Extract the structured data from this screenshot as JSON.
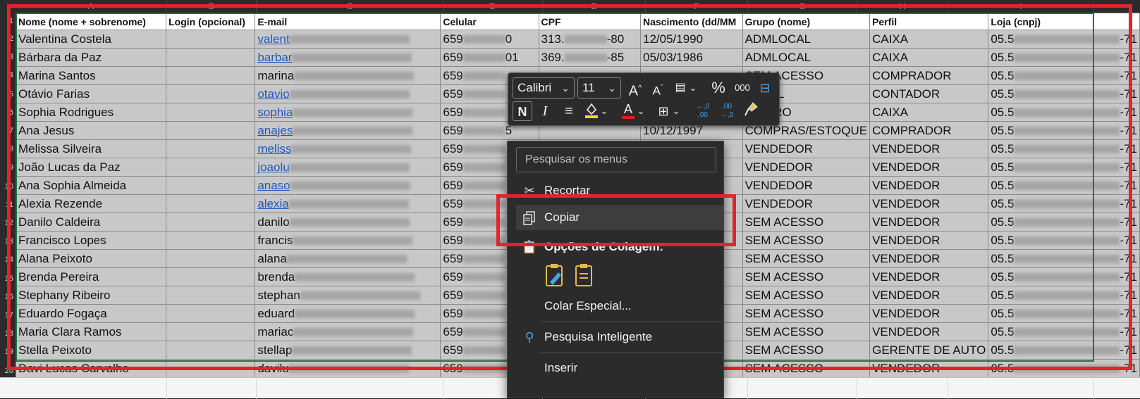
{
  "columns": [
    "A",
    "B",
    "C",
    "D",
    "E",
    "F",
    "G",
    "H",
    "I"
  ],
  "headers": [
    "Nome (nome + sobrenome)",
    "Login (opcional)",
    "E-mail",
    "Celular",
    "CPF",
    "Nascimento (dd/MM",
    "Grupo (nome)",
    "Perfil",
    "Loja (cnpj)"
  ],
  "rows": [
    {
      "n": "1",
      "nome": "Valentina Costela",
      "email": "valent",
      "email_style": "link",
      "cel_a": "659",
      "cel_b": "0",
      "cpf_a": "313.",
      "cpf_b": "-80",
      "nasc": "12/05/1990",
      "grupo": "ADMLOCAL",
      "perfil": "CAIXA",
      "loja_a": "05.5",
      "loja_b": "-71"
    },
    {
      "n": "2",
      "nome": "Bárbara da Paz",
      "email": "barbar",
      "email_style": "link",
      "cel_a": "659",
      "cel_b": "01",
      "cpf_a": "369.",
      "cpf_b": "-85",
      "nasc": "05/03/1986",
      "grupo": "ADMLOCAL",
      "perfil": "CAIXA",
      "loja_a": "05.5",
      "loja_b": "-71"
    },
    {
      "n": "3",
      "nome": "Marina Santos",
      "email": "marina",
      "email_style": "plain",
      "cel_a": "659",
      "cel_b": "",
      "cpf_a": "",
      "cpf_b": "",
      "nasc": "",
      "grupo": "SEM ACESSO",
      "perfil": "COMPRADOR",
      "loja_a": "05.5",
      "loja_b": "-71"
    },
    {
      "n": "4",
      "nome": "Otávio Farias",
      "email": "otavio",
      "email_style": "link",
      "cel_a": "659",
      "cel_b": "",
      "cpf_a": "",
      "cpf_b": "",
      "nasc": "",
      "grupo": "LOCAL",
      "perfil": "CONTADOR",
      "loja_a": "05.5",
      "loja_b": "-71"
    },
    {
      "n": "5",
      "nome": "Sophia Rodrigues",
      "email": "sophia",
      "email_style": "link",
      "cel_a": "659",
      "cel_b": "",
      "cpf_a": "",
      "cpf_b": "",
      "nasc": "",
      "grupo": "NCEIRO",
      "perfil": "CAIXA",
      "loja_a": "05.5",
      "loja_b": "-71"
    },
    {
      "n": "6",
      "nome": "Ana Jesus",
      "email": "anajes",
      "email_style": "link",
      "cel_a": "659",
      "cel_b": "5",
      "cpf_a": "",
      "cpf_b": "",
      "nasc": "10/12/1997",
      "grupo": "COMPRAS/ESTOQUE",
      "perfil": "COMPRADOR",
      "loja_a": "05.5",
      "loja_b": "-71"
    },
    {
      "n": "7",
      "nome": "Melissa Silveira",
      "email": "meliss",
      "email_style": "link",
      "cel_a": "659",
      "cel_b": "",
      "cpf_a": "",
      "cpf_b": "",
      "nasc": "",
      "grupo": "VENDEDOR",
      "perfil": "VENDEDOR",
      "loja_a": "05.5",
      "loja_b": "-71"
    },
    {
      "n": "8",
      "nome": "João Lucas da Paz",
      "email": "joaolu",
      "email_style": "link",
      "cel_a": "659",
      "cel_b": "",
      "cpf_a": "",
      "cpf_b": "",
      "nasc": "",
      "grupo": "VENDEDOR",
      "perfil": "VENDEDOR",
      "loja_a": "05.5",
      "loja_b": "-71"
    },
    {
      "n": "9",
      "nome": "Ana Sophia Almeida",
      "email": "anaso",
      "email_style": "link",
      "cel_a": "659",
      "cel_b": "",
      "cpf_a": "",
      "cpf_b": "",
      "nasc": "",
      "grupo": "VENDEDOR",
      "perfil": "VENDEDOR",
      "loja_a": "05.5",
      "loja_b": "-71"
    },
    {
      "n": "10",
      "nome": "Alexia Rezende",
      "email": "alexia",
      "email_style": "link",
      "cel_a": "659",
      "cel_b": "",
      "cpf_a": "",
      "cpf_b": "",
      "nasc": "",
      "grupo": "VENDEDOR",
      "perfil": "VENDEDOR",
      "loja_a": "05.5",
      "loja_b": "-71"
    },
    {
      "n": "11",
      "nome": "Danilo Caldeira",
      "email": "danilo",
      "email_style": "plain",
      "cel_a": "659",
      "cel_b": "",
      "cpf_a": "",
      "cpf_b": "",
      "nasc": "",
      "grupo": "SEM ACESSO",
      "perfil": "VENDEDOR",
      "loja_a": "05.5",
      "loja_b": "-71"
    },
    {
      "n": "12",
      "nome": "Francisco Lopes",
      "email": "francis",
      "email_style": "plain",
      "cel_a": "659",
      "cel_b": "",
      "cpf_a": "",
      "cpf_b": "",
      "nasc": "",
      "grupo": "SEM ACESSO",
      "perfil": "VENDEDOR",
      "loja_a": "05.5",
      "loja_b": "-71"
    },
    {
      "n": "13",
      "nome": "Alana Peixoto",
      "email": "alana",
      "email_style": "plain",
      "cel_a": "659",
      "cel_b": "",
      "cpf_a": "",
      "cpf_b": "",
      "nasc": "",
      "grupo": "SEM ACESSO",
      "perfil": "VENDEDOR",
      "loja_a": "05.5",
      "loja_b": "-71"
    },
    {
      "n": "14",
      "nome": "Brenda Pereira",
      "email": "brenda",
      "email_style": "plain",
      "cel_a": "659",
      "cel_b": "",
      "cpf_a": "",
      "cpf_b": "",
      "nasc": "",
      "grupo": "SEM ACESSO",
      "perfil": "VENDEDOR",
      "loja_a": "05.5",
      "loja_b": "-71"
    },
    {
      "n": "15",
      "nome": "Stephany Ribeiro",
      "email": "stephan",
      "email_style": "plain",
      "cel_a": "659",
      "cel_b": "",
      "cpf_a": "",
      "cpf_b": "",
      "nasc": "",
      "grupo": "SEM ACESSO",
      "perfil": "VENDEDOR",
      "loja_a": "05.5",
      "loja_b": "-71"
    },
    {
      "n": "16",
      "nome": "Eduardo Fogaça",
      "email": "eduard",
      "email_style": "plain",
      "cel_a": "659",
      "cel_b": "",
      "cpf_a": "",
      "cpf_b": "",
      "nasc": "",
      "grupo": "SEM ACESSO",
      "perfil": "VENDEDOR",
      "loja_a": "05.5",
      "loja_b": "-71"
    },
    {
      "n": "17",
      "nome": "Maria Clara Ramos",
      "email": "mariac",
      "email_style": "plain",
      "cel_a": "659",
      "cel_b": "",
      "cpf_a": "",
      "cpf_b": "",
      "nasc": "",
      "grupo": "SEM ACESSO",
      "perfil": "VENDEDOR",
      "loja_a": "05.5",
      "loja_b": "-71"
    },
    {
      "n": "18",
      "nome": "Stella Peixoto",
      "email": "stellap",
      "email_style": "plain",
      "cel_a": "659",
      "cel_b": "",
      "cpf_a": "",
      "cpf_b": "",
      "nasc": "",
      "grupo": "SEM ACESSO",
      "perfil": "GERENTE DE AUTO",
      "loja_a": "05.5",
      "loja_b": "-71"
    },
    {
      "n": "19",
      "nome": "Davi Lucas Carvalho",
      "email": "davilu",
      "email_style": "plain",
      "cel_a": "659",
      "cel_b": "",
      "cpf_a": "",
      "cpf_b": "",
      "nasc": "",
      "grupo": "SEM ACESSO",
      "perfil": "VENDEDOR",
      "loja_a": "05.5",
      "loja_b": "-71"
    }
  ],
  "mini_toolbar": {
    "font_name": "Calibri",
    "font_size": "11",
    "bold_label": "N",
    "italic_label": "I",
    "percent_label": "%",
    "thousands_label": "000",
    "increase_decimal_label": "←,0\n,00",
    "decrease_decimal_label": ",00\n→,0"
  },
  "context_menu": {
    "search_placeholder": "Pesquisar os menus",
    "cut": "Recortar",
    "copy": "Copiar",
    "paste_options": "Opções de Colagem:",
    "paste_special": "Colar Especial...",
    "smart_lookup": "Pesquisa Inteligente",
    "insert": "Inserir"
  },
  "colors": {
    "selection_border": "#217346",
    "highlight": "#e3242b",
    "link": "#1f56c0",
    "cell_fill": "#c8c8c8"
  }
}
